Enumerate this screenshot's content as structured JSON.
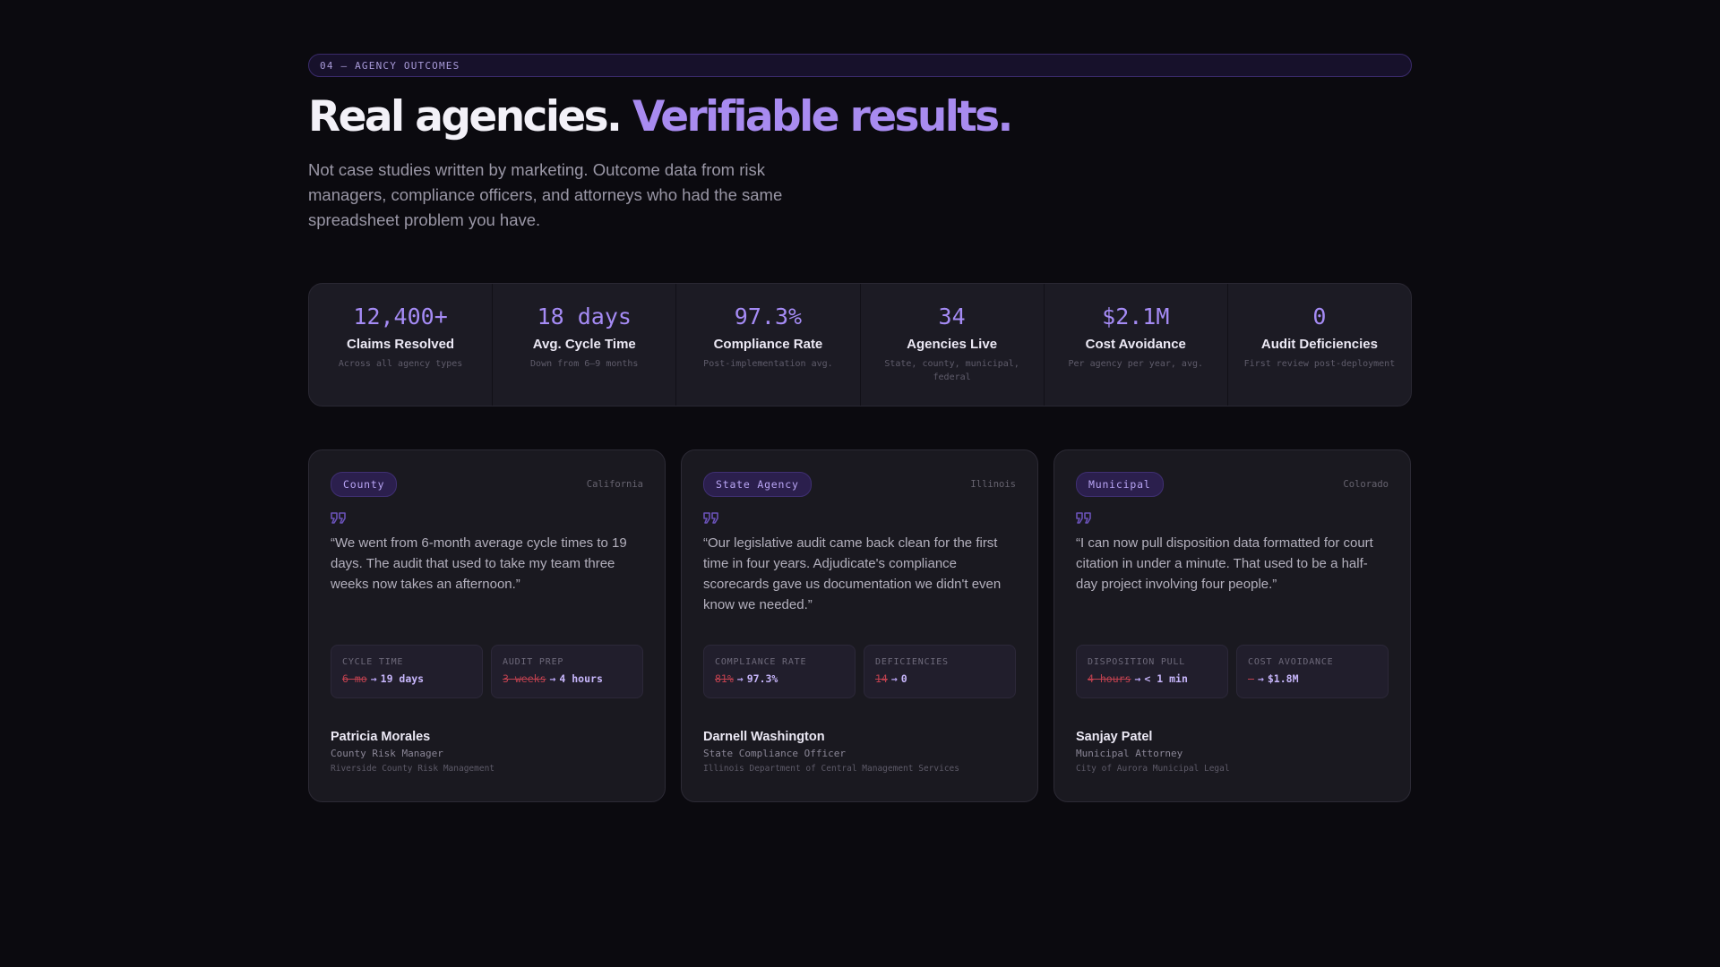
{
  "section": {
    "tag": "04 — AGENCY OUTCOMES"
  },
  "hero": {
    "title_part1": "Real agencies. ",
    "title_part2": "Verifiable results.",
    "subtext": "Not case studies written by marketing. Outcome data from risk managers, compliance officers, and attorneys who had the same spreadsheet problem you have."
  },
  "stats": [
    {
      "value": "12,400+",
      "label": "Claims Resolved",
      "sub": "Across all agency types"
    },
    {
      "value": "18 days",
      "label": "Avg. Cycle Time",
      "sub": "Down from 6–9 months"
    },
    {
      "value": "97.3%",
      "label": "Compliance Rate",
      "sub": "Post-implementation avg."
    },
    {
      "value": "34",
      "label": "Agencies Live",
      "sub": "State, county, municipal, federal"
    },
    {
      "value": "$2.1M",
      "label": "Cost Avoidance",
      "sub": "Per agency per year, avg."
    },
    {
      "value": "0",
      "label": "Audit Deficiencies",
      "sub": "First review post-deployment"
    }
  ],
  "testimonials": [
    {
      "badge": "County",
      "region": "California",
      "quote": "“We went from 6-month average cycle times to 19 days. The audit that used to take my team three weeks now takes an afternoon.”",
      "metrics": [
        {
          "label": "CYCLE TIME",
          "before": "6 mo",
          "arrow": "→",
          "after": "19 days"
        },
        {
          "label": "AUDIT PREP",
          "before": "3 weeks",
          "arrow": "→",
          "after": "4 hours"
        }
      ],
      "name": "Patricia Morales",
      "role": "County Risk Manager",
      "org": "Riverside County Risk Management"
    },
    {
      "badge": "State Agency",
      "region": "Illinois",
      "quote": "“Our legislative audit came back clean for the first time in four years. Adjudicate's compliance scorecards gave us documentation we didn't even know we needed.”",
      "metrics": [
        {
          "label": "COMPLIANCE RATE",
          "before": "81%",
          "arrow": "→",
          "after": "97.3%"
        },
        {
          "label": "DEFICIENCIES",
          "before": "14",
          "arrow": "→",
          "after": "0"
        }
      ],
      "name": "Darnell Washington",
      "role": "State Compliance Officer",
      "org": "Illinois Department of Central Management Services"
    },
    {
      "badge": "Municipal",
      "region": "Colorado",
      "quote": "“I can now pull disposition data formatted for court citation in under a minute. That used to be a half-day project involving four people.”",
      "metrics": [
        {
          "label": "DISPOSITION PULL",
          "before": "4 hours",
          "arrow": "→",
          "after": "< 1 min"
        },
        {
          "label": "COST AVOIDANCE",
          "before": "—",
          "arrow": "→",
          "after": "$1.8M"
        }
      ],
      "name": "Sanjay Patel",
      "role": "Municipal Attorney",
      "org": "City of Aurora Municipal Legal"
    }
  ],
  "colors": {
    "background": "#0b0a0f",
    "accent": "#a88bf0",
    "before_value": "#c0414f"
  },
  "icons": {
    "quote": "quote-icon"
  }
}
